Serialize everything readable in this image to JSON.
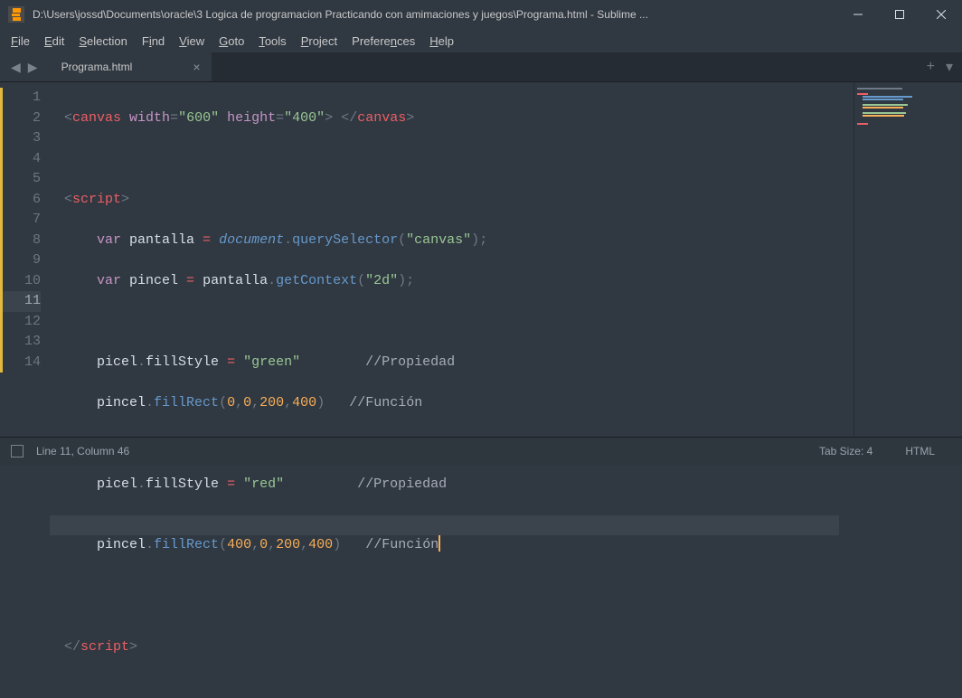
{
  "title": "D:\\Users\\jossd\\Documents\\oracle\\3 Logica de programacion Practicando con amimaciones y juegos\\Programa.html - Sublime ...",
  "menu": {
    "items": [
      "File",
      "Edit",
      "Selection",
      "Find",
      "View",
      "Goto",
      "Tools",
      "Project",
      "Preferences",
      "Help"
    ]
  },
  "tabs": {
    "active": "Programa.html"
  },
  "gutter": {
    "lines": [
      "1",
      "2",
      "3",
      "4",
      "5",
      "6",
      "7",
      "8",
      "9",
      "10",
      "11",
      "12",
      "13",
      "14"
    ],
    "current": 10
  },
  "code": {
    "l1": {
      "open": "<",
      "tag": "canvas",
      "sp": " ",
      "a1": "width",
      "eq": "=",
      "v1": "\"600\"",
      "a2": "height",
      "v2": "\"400\"",
      "close": ">",
      "mid": " ",
      "endopen": "</",
      "endtag": "canvas",
      "endclose": ">"
    },
    "l3": {
      "open": "<",
      "tag": "script",
      "close": ">"
    },
    "l4": {
      "kw": "var",
      "id": " pantalla ",
      "eq": "=",
      "obj": "document",
      "dot": ".",
      "fn": "querySelector",
      "paren": "(",
      "arg": "\"canvas\"",
      "paren2": ")",
      "semi": ";"
    },
    "l5": {
      "kw": "var",
      "id": " pincel ",
      "eq": "=",
      "obj": " pantalla",
      "dot": ".",
      "fn": "getContext",
      "paren": "(",
      "arg": "\"2d\"",
      "paren2": ")",
      "semi": ";"
    },
    "l7": {
      "obj": "picel",
      "dot": ".",
      "prop": "fillStyle ",
      "eq": "=",
      "val": " \"green\"",
      "pad": "        ",
      "com": "//Propiedad"
    },
    "l8": {
      "obj": "pincel",
      "dot": ".",
      "fn": "fillRect",
      "paren": "(",
      "a1": "0",
      "c1": ",",
      "a2": "0",
      "c2": ",",
      "a3": "200",
      "c3": ",",
      "a4": "400",
      "paren2": ")",
      "pad": "   ",
      "com": "//Función"
    },
    "l10": {
      "obj": "picel",
      "dot": ".",
      "prop": "fillStyle ",
      "eq": "=",
      "val": " \"red\"",
      "pad": "         ",
      "com": "//Propiedad"
    },
    "l11": {
      "obj": "pincel",
      "dot": ".",
      "fn": "fillRect",
      "paren": "(",
      "a1": "400",
      "c1": ",",
      "a2": "0",
      "c2": ",",
      "a3": "200",
      "c3": ",",
      "a4": "400",
      "paren2": ")",
      "pad": "   ",
      "com": "//Función"
    },
    "l14": {
      "open": "</",
      "tag": "script",
      "close": ">"
    }
  },
  "status": {
    "pos": "Line 11, Column 46",
    "tabsize": "Tab Size: 4",
    "lang": "HTML"
  }
}
